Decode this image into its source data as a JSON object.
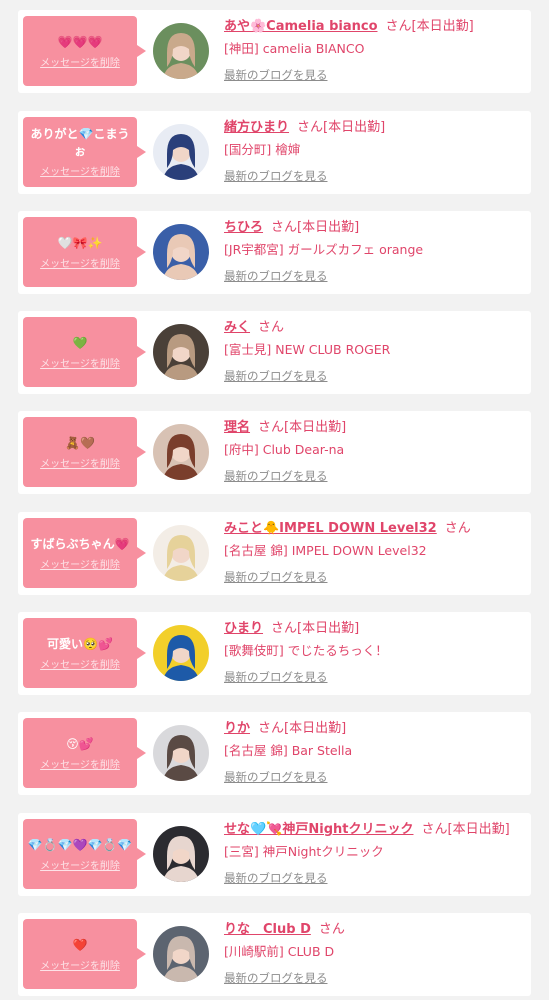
{
  "colors": {
    "bubble": "#f7909f",
    "accent": "#e0456a",
    "blog_link": "#8c8c8c",
    "card": "#ffffff",
    "background": "#f2f2f2"
  },
  "entries": [
    {
      "message": "💗💗💗",
      "delete_label": "メッセージを削除",
      "name": "あや🌸Camelia bianco",
      "suffix": "さん",
      "status": "[本日出勤]",
      "shop": "[神田] camelia BIANCO",
      "blog_label": "最新のブログを見る",
      "avatar_colors": [
        "#6b8f5e",
        "#c9a98b"
      ]
    },
    {
      "message": "ありがと💎こまうぉ",
      "delete_label": "メッセージを削除",
      "name": "緒方ひまり",
      "suffix": "さん",
      "status": "[本日出勤]",
      "shop": "[国分町] 檜婶",
      "blog_label": "最新のブログを見る",
      "avatar_colors": [
        "#e8ecf4",
        "#2a3f7a"
      ]
    },
    {
      "message": "🤍🎀✨",
      "delete_label": "メッセージを削除",
      "name": "ちひろ",
      "suffix": "さん",
      "status": "[本日出勤]",
      "shop": "[JR宇都宮] ガールズカフェ orange",
      "blog_label": "最新のブログを見る",
      "avatar_colors": [
        "#3a5fa8",
        "#e9c9b6"
      ]
    },
    {
      "message": "💚",
      "delete_label": "メッセージを削除",
      "name": "みく",
      "suffix": "さん",
      "status": "",
      "shop": "[富士見] NEW CLUB ROGER",
      "blog_label": "最新のブログを見る",
      "avatar_colors": [
        "#4a4038",
        "#b89a80"
      ]
    },
    {
      "message": "🧸🤎",
      "delete_label": "メッセージを削除",
      "name": "理名",
      "suffix": "さん",
      "status": "[本日出勤]",
      "shop": "[府中] Club Dear-na",
      "blog_label": "最新のブログを見る",
      "avatar_colors": [
        "#d8c2b4",
        "#7a3e2c"
      ]
    },
    {
      "message": "すばらぶちゃん💗",
      "delete_label": "メッセージを削除",
      "name": "みこと🐥IMPEL DOWN Level32",
      "suffix": "さん",
      "status": "",
      "shop": "[名古屋 錦] IMPEL DOWN Level32",
      "blog_label": "最新のブログを見る",
      "avatar_colors": [
        "#f3ede6",
        "#e6d29a"
      ]
    },
    {
      "message": "可愛い🥺💕",
      "delete_label": "メッセージを削除",
      "name": "ひまり",
      "suffix": "さん",
      "status": "[本日出勤]",
      "shop": "[歌舞伎町] でじたるちっく！",
      "blog_label": "最新のブログを見る",
      "avatar_colors": [
        "#f2cf2a",
        "#1d5aa8"
      ]
    },
    {
      "message": "😚💕",
      "delete_label": "メッセージを削除",
      "name": "りか",
      "suffix": "さん",
      "status": "[本日出勤]",
      "shop": "[名古屋 錦] Bar Stella",
      "blog_label": "最新のブログを見る",
      "avatar_colors": [
        "#d9d9dc",
        "#5a4a44"
      ]
    },
    {
      "message": "💎💍💎💜💎💍💎",
      "delete_label": "メッセージを削除",
      "name": "せな🩵💘神戸Nightクリニック",
      "suffix": "さん",
      "status": "[本日出勤]",
      "shop": "[三宮] 神戸Nightクリニック",
      "blog_label": "最新のブログを見る",
      "avatar_colors": [
        "#2b2b30",
        "#e7d6cf"
      ]
    },
    {
      "message": "❤️",
      "delete_label": "メッセージを削除",
      "name": "りな　Club D",
      "suffix": "さん",
      "status": "",
      "shop": "[川崎駅前] CLUB D",
      "blog_label": "最新のブログを見る",
      "avatar_colors": [
        "#5c6470",
        "#c9b8ae"
      ]
    }
  ]
}
